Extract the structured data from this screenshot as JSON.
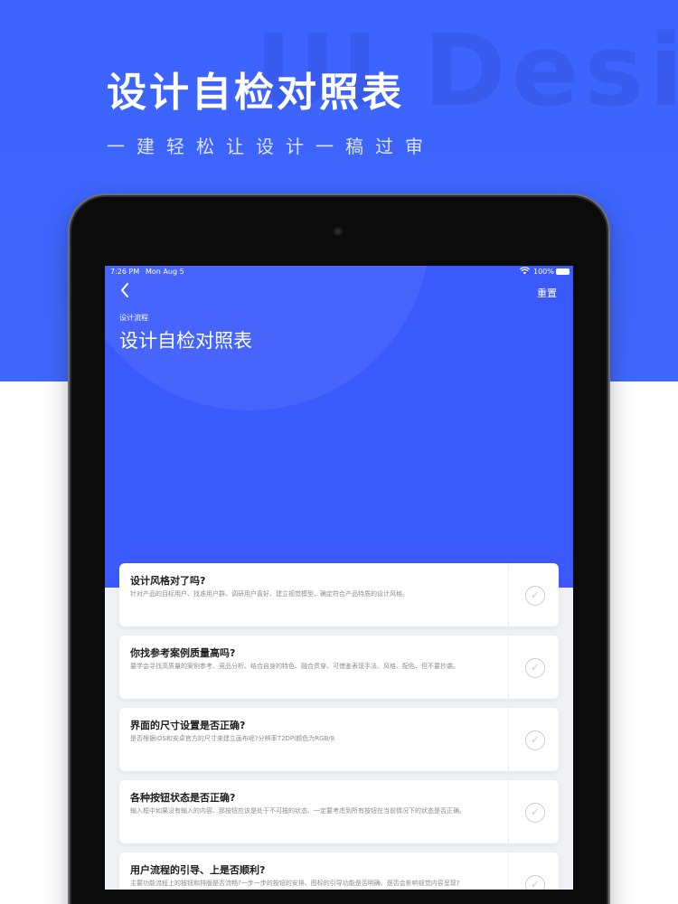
{
  "hero": {
    "watermark": "UI Design",
    "title": "设计自检对照表",
    "subtitle": "一建轻松让设计一稿过审"
  },
  "status_bar": {
    "time": "7:26 PM",
    "date": "Mon Aug 5",
    "battery": "100%"
  },
  "screen": {
    "back_icon": "chevron-left-icon",
    "reset_label": "重置",
    "breadcrumb": "设计流程",
    "title": "设计自检对照表"
  },
  "checklist": [
    {
      "question": "设计风格对了吗?",
      "description": "针对产品的目标用户、找准用户群、调研用户喜好、建立视觉模型、确定符合产品特质的设计风格。"
    },
    {
      "question": "你找参考案例质量高吗?",
      "description": "要学会寻找高质量的案例参考、竞品分析、结合自身的特色、融合贯穿、可借鉴表现手法、风格、配色、但不要抄袭。"
    },
    {
      "question": "界面的尺寸设置是否正确?",
      "description": "是否根据iOS和安卓官方的尺寸来建立画布呢?分辨率72DPI颜色为RGB/8"
    },
    {
      "question": "各种按钮状态是否正确?",
      "description": "输入框中如果没有输入的内容、那按钮应该是处于不可按的状态、一定要考虑到所有按钮在当前情况下的状态是否正确。"
    },
    {
      "question": "用户流程的引导、上是否顺利?",
      "description": "主要功能流程上的按钮和排版是否流畅?一步一步的按钮的安排、图标的引导功能是否明确、是否会影响视觉内容呈现?"
    }
  ],
  "colors": {
    "hero_blue": "#3d63ff",
    "screen_blue": "#3a5afc",
    "card_bg": "#ffffff",
    "check_gray": "#c9ccd2"
  }
}
